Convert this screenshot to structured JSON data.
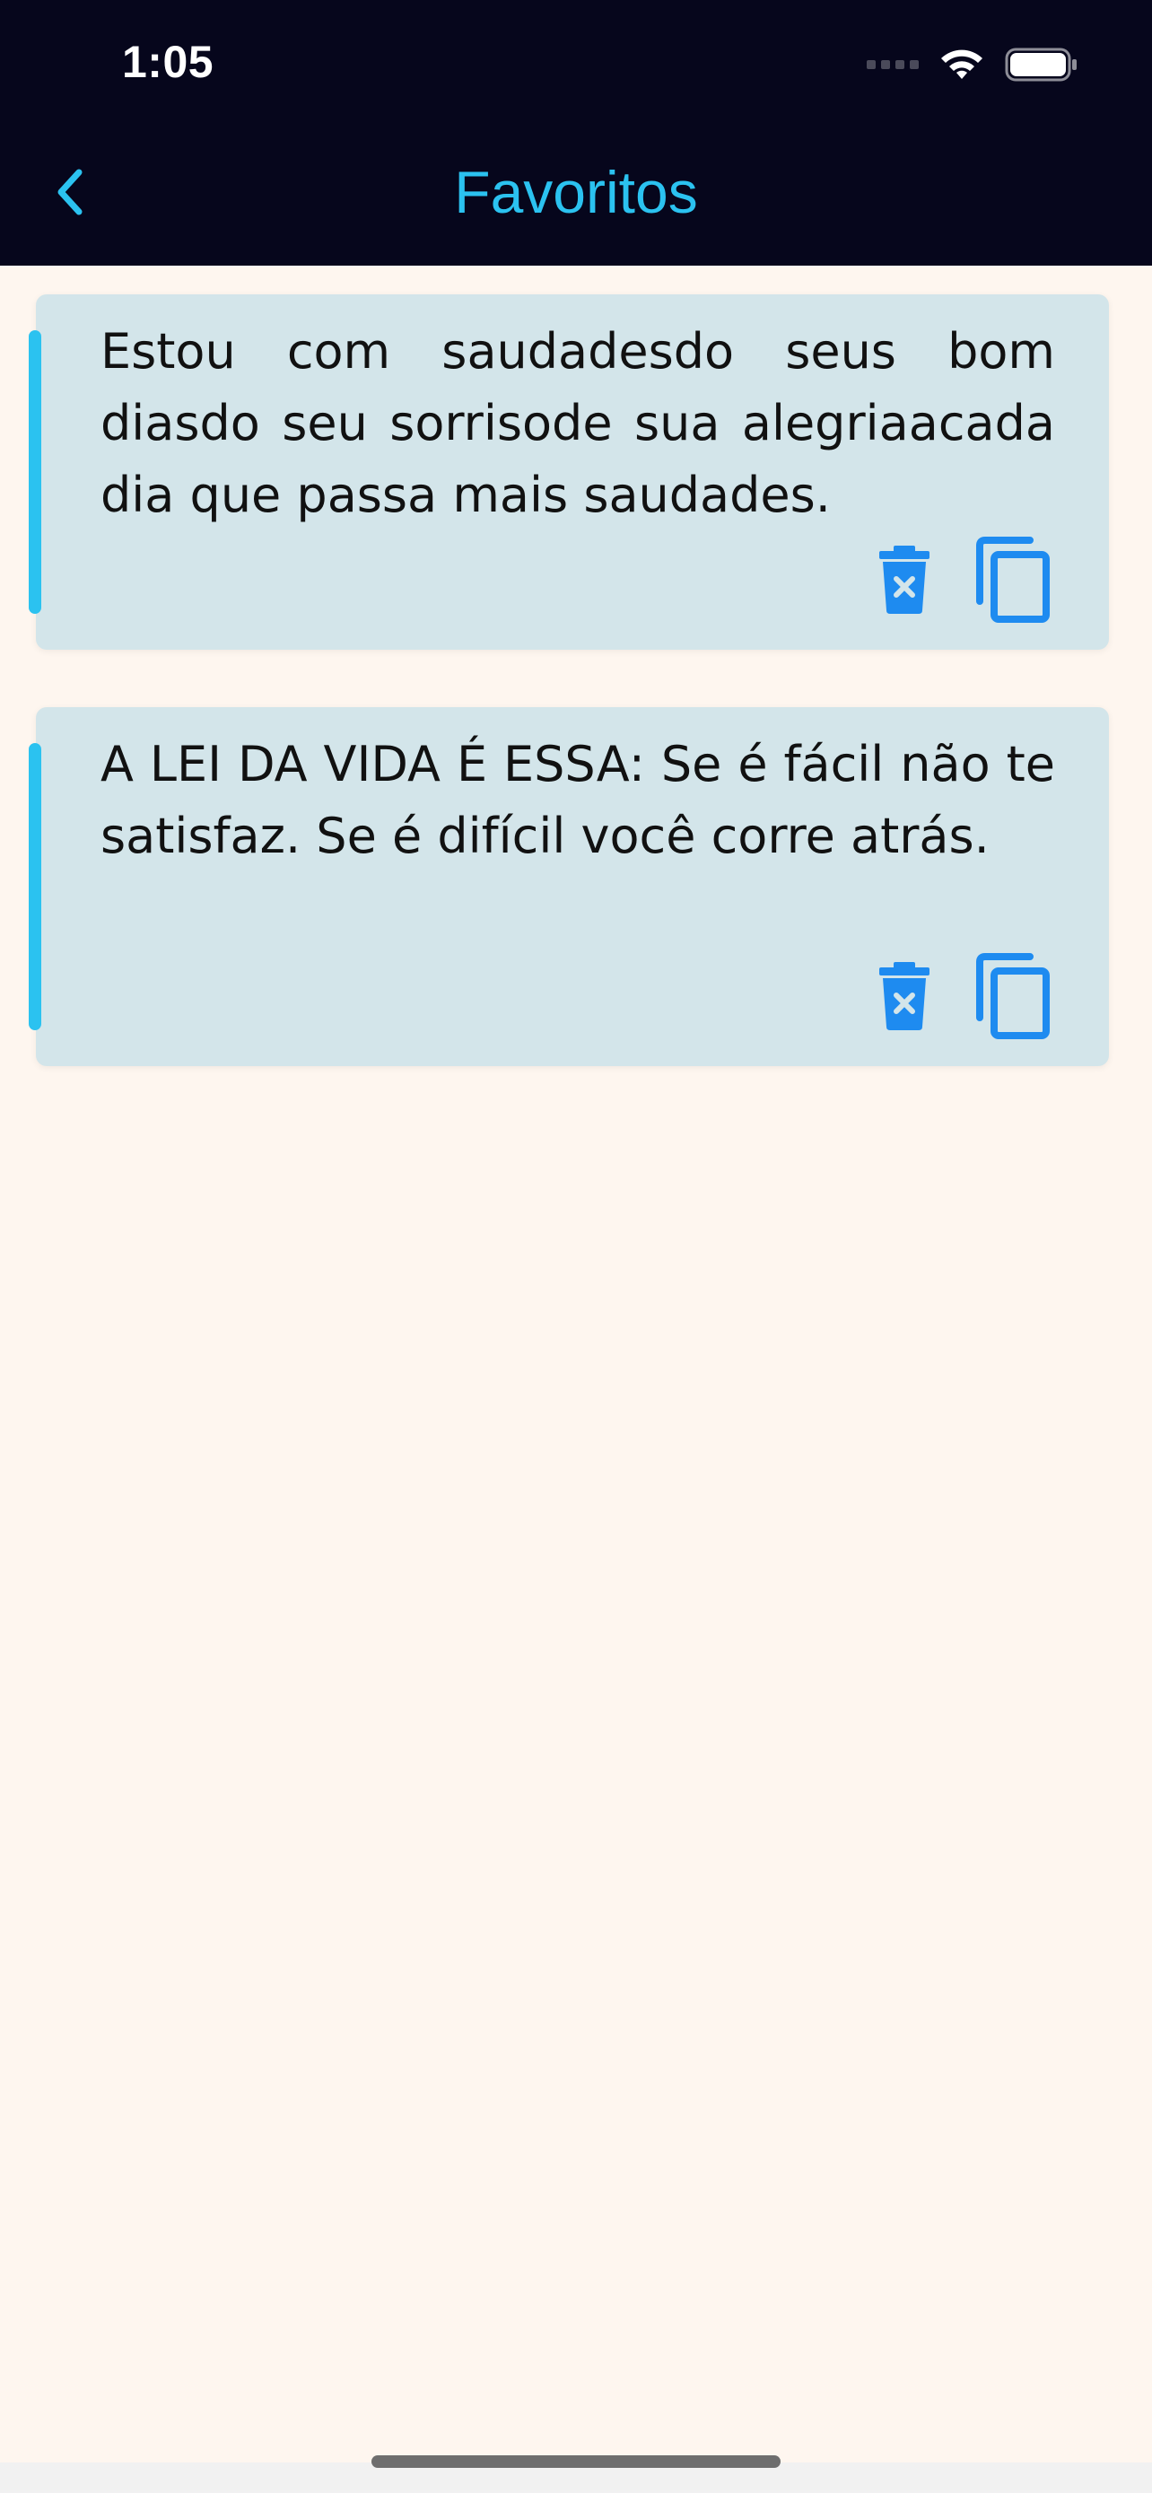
{
  "status_bar": {
    "time": "1:05",
    "wifi_icon": "wifi-icon",
    "battery_icon": "battery-icon",
    "signal_icon": "cellular-dots-icon"
  },
  "nav": {
    "title": "Favoritos",
    "back_icon": "chevron-left-icon"
  },
  "favorites": [
    {
      "text": "Estou com saudadesdo seus bom diasdo seu sorrisode sua alegriaacada dia que passa mais saudades.",
      "delete_icon": "trash-x-icon",
      "copy_icon": "copy-icon"
    },
    {
      "text": "A LEI DA VIDA É ESSA: Se é fácil não te satisfaz. Se é difícil você corre atrás.",
      "delete_icon": "trash-x-icon",
      "copy_icon": "copy-icon"
    }
  ],
  "colors": {
    "topbar": "#06061C",
    "accent": "#2BC2F0",
    "background": "#FEF6EF",
    "card": "#D3E5EA",
    "icon_blue": "#1E8BF0"
  }
}
